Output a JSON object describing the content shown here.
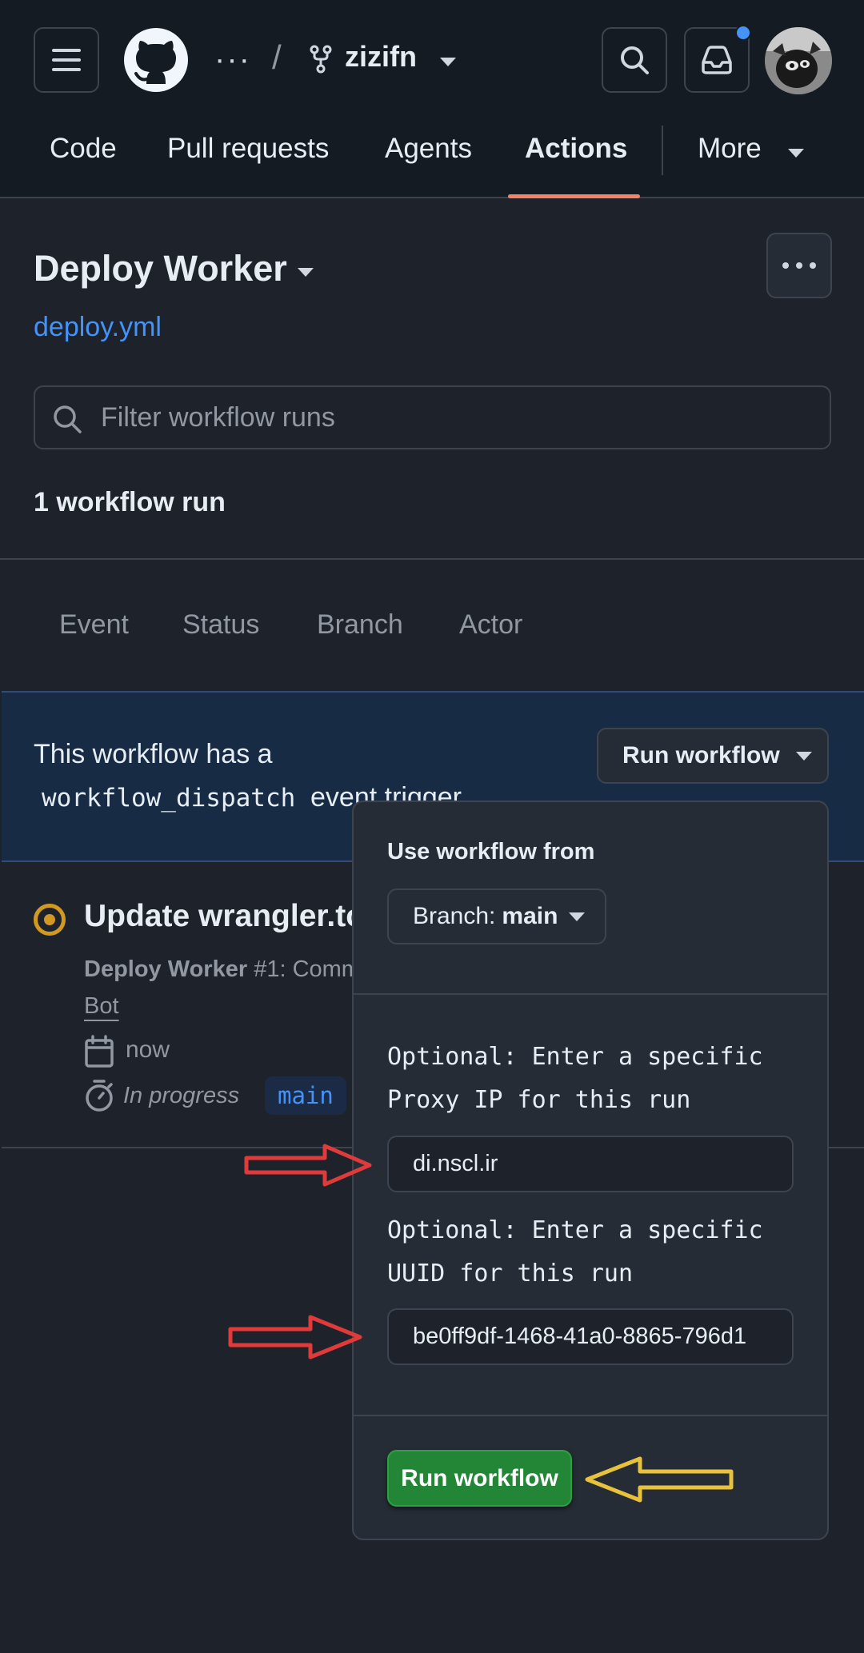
{
  "header": {
    "menu_icon": "hamburger-menu-icon",
    "logo_icon": "github-logo-icon",
    "breadcrumb_dots": "···",
    "breadcrumb_separator": "/",
    "repo_name": "zizifn",
    "search_icon": "search-icon",
    "inbox_icon": "inbox-icon",
    "notification_indicator": true,
    "avatar": "user-avatar"
  },
  "nav": {
    "tabs": [
      "Code",
      "Pull requests",
      "Agents",
      "Actions"
    ],
    "active_tab": "Actions",
    "more_label": "More"
  },
  "workflow": {
    "title": "Deploy Worker",
    "file": "deploy.yml",
    "filter_placeholder": "Filter workflow runs",
    "run_count": "1 workflow run"
  },
  "filters": [
    "Event",
    "Status",
    "Branch",
    "Actor"
  ],
  "dispatch_banner": {
    "text_before": "This workflow has a",
    "code": "workflow_dispatch",
    "text_after": "event trigger.",
    "button_label": "Run workflow"
  },
  "run": {
    "title": "Update wrangler.to",
    "workflow_name": "Deploy Worker",
    "run_number": "#1: Comm",
    "actor": "Bot",
    "time": "now",
    "status": "In progress",
    "branch": "main"
  },
  "dropdown": {
    "use_from_label": "Use workflow from",
    "branch_prefix": "Branch:",
    "branch_value": "main",
    "proxy_label": "Optional: Enter a specific\nProxy IP for this run",
    "proxy_value": "di.nscl.ir",
    "uuid_label": "Optional: Enter a specific\nUUID for this run",
    "uuid_value": "be0ff9df-1468-41a0-8865-796d1",
    "run_button": "Run workflow"
  },
  "annotations": {
    "arrow_colors": {
      "red": "#e03a3a",
      "yellow": "#e8c23a"
    }
  },
  "colors": {
    "accent_underline": "#f78166",
    "link": "#4493f8",
    "run_button": "#238636",
    "in_progress": "#d29922"
  }
}
